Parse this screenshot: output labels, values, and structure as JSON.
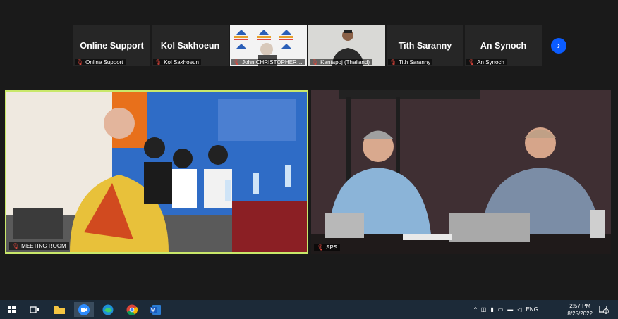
{
  "participants": [
    {
      "name": "Online Support",
      "caption": "Online Support"
    },
    {
      "name": "Kol Sakhoeun",
      "caption": "Kol Sakhoeun"
    },
    {
      "name": "",
      "caption": "John CHRISTOPHER, P..."
    },
    {
      "name": "",
      "caption": "Kantapoj (Thailand)"
    },
    {
      "name": "Tith Saranny",
      "caption": "Tith Saranny"
    },
    {
      "name": "An Synoch",
      "caption": "An Synoch"
    }
  ],
  "next_icon": "chevron-right-icon",
  "videos": [
    {
      "label": "MEETING ROOM"
    },
    {
      "label": "SPS"
    }
  ],
  "taskbar": {
    "tray_lang": "ENG",
    "time": "2:57 PM",
    "date": "8/25/2022",
    "notification_count": "1"
  },
  "colors": {
    "active_speaker_border": "#c9e86a",
    "accent": "#0b5cff",
    "muted_mic": "#e0453b"
  }
}
